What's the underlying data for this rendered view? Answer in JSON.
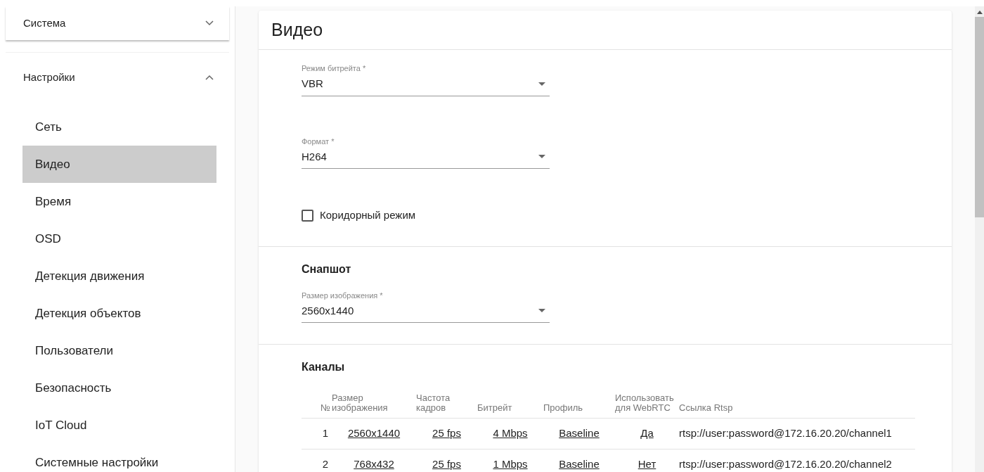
{
  "sidebar": {
    "groups": [
      {
        "label": "Система",
        "expanded": false
      },
      {
        "label": "Настройки",
        "expanded": true,
        "items": [
          {
            "label": "Сеть",
            "selected": false
          },
          {
            "label": "Видео",
            "selected": true
          },
          {
            "label": "Время",
            "selected": false
          },
          {
            "label": "OSD",
            "selected": false
          },
          {
            "label": "Детекция движения",
            "selected": false
          },
          {
            "label": "Детекция объектов",
            "selected": false
          },
          {
            "label": "Пользователи",
            "selected": false
          },
          {
            "label": "Безопасность",
            "selected": false
          },
          {
            "label": "IoT Cloud",
            "selected": false
          },
          {
            "label": "Системные настройки",
            "selected": false
          }
        ]
      }
    ]
  },
  "card": {
    "title": "Видео",
    "sections": [
      {
        "items": [
          {
            "kind": "select",
            "label": "Режим битрейта *",
            "value": "VBR"
          },
          {
            "kind": "select",
            "label": "Формат *",
            "value": "H264"
          },
          {
            "kind": "checkbox",
            "label": "Коридорный режим",
            "checked": false
          }
        ]
      },
      {
        "heading": "Снапшот",
        "items": [
          {
            "kind": "select",
            "label": "Размер изображения *",
            "value": "2560x1440"
          }
        ]
      },
      {
        "heading": "Каналы",
        "items": [
          {
            "kind": "table",
            "columns": [
              "№",
              "Размер изображения",
              "Частота кадров",
              "Битрейт",
              "Профиль",
              "Использовать для WebRTC",
              "Ссылка Rtsp"
            ],
            "rows": [
              [
                "1",
                "2560x1440",
                "25 fps",
                "4 Mbps",
                "Baseline",
                "Да",
                "rtsp://user:password@172.16.20.20/channel1"
              ],
              [
                "2",
                "768x432",
                "25 fps",
                "1 Mbps",
                "Baseline",
                "Нет",
                "rtsp://user:password@172.16.20.20/channel2"
              ]
            ]
          }
        ]
      }
    ]
  }
}
